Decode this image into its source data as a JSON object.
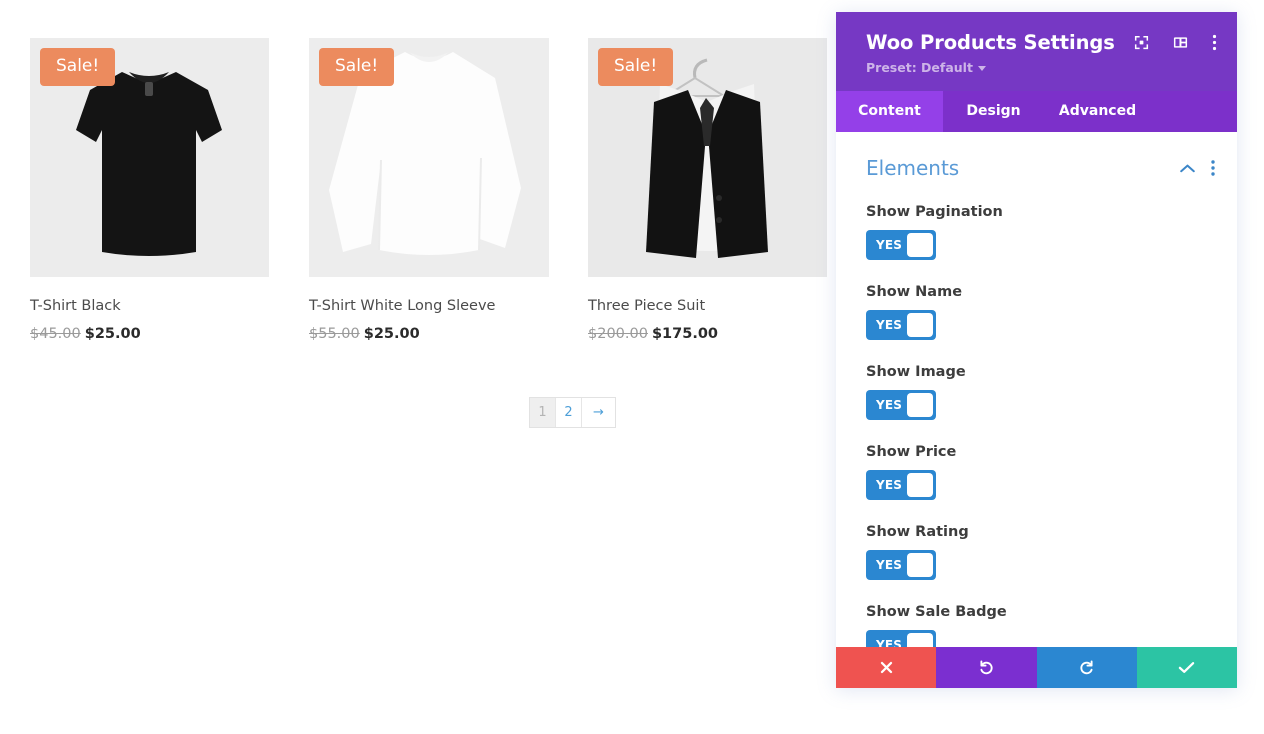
{
  "products": [
    {
      "title": "T-Shirt Black",
      "badge": "Sale!",
      "old_price": "$45.00",
      "new_price": "$25.00",
      "image": "black-tshirt-photo"
    },
    {
      "title": "T-Shirt White Long Sleeve",
      "badge": "Sale!",
      "old_price": "$55.00",
      "new_price": "$25.00",
      "image": "white-long-sleeve-tshirt-photo"
    },
    {
      "title": "Three Piece Suit",
      "badge": "Sale!",
      "old_price": "$200.00",
      "new_price": "$175.00",
      "image": "three-piece-suit-photo"
    }
  ],
  "pagination": {
    "current": "1",
    "next_page": "2",
    "next_arrow": "→"
  },
  "panel": {
    "title": "Woo Products Settings",
    "preset_label": "Preset: Default",
    "header_icons": [
      {
        "name": "fullscreen-icon"
      },
      {
        "name": "layout-panel-icon"
      },
      {
        "name": "more-vertical-icon"
      }
    ],
    "tabs": [
      {
        "label": "Content",
        "active": true
      },
      {
        "label": "Design",
        "active": false
      },
      {
        "label": "Advanced",
        "active": false
      }
    ],
    "section": {
      "title": "Elements",
      "collapse_icon": "chevron-up-icon",
      "menu_icon": "more-vertical-icon"
    },
    "fields": [
      {
        "label": "Show Pagination",
        "value": "YES"
      },
      {
        "label": "Show Name",
        "value": "YES"
      },
      {
        "label": "Show Image",
        "value": "YES"
      },
      {
        "label": "Show Price",
        "value": "YES"
      },
      {
        "label": "Show Rating",
        "value": "YES"
      },
      {
        "label": "Show Sale Badge",
        "value": "YES"
      }
    ],
    "footer": [
      {
        "name": "cancel-button",
        "icon": "✖"
      },
      {
        "name": "undo-button",
        "icon": "↺"
      },
      {
        "name": "redo-button",
        "icon": "↻"
      },
      {
        "name": "save-button",
        "icon": "✔"
      }
    ]
  },
  "colors": {
    "panel_header": "#7638c4",
    "tab_bar": "#7c30ca",
    "tab_active": "#9440e8",
    "toggle_on": "#2b87d1",
    "section_title": "#5a9ad6",
    "sale_badge": "#ec8b5e",
    "footer_close": "#ef5350",
    "footer_undo": "#7b2fd0",
    "footer_redo": "#2b87d1",
    "footer_save": "#2cc4a4"
  }
}
